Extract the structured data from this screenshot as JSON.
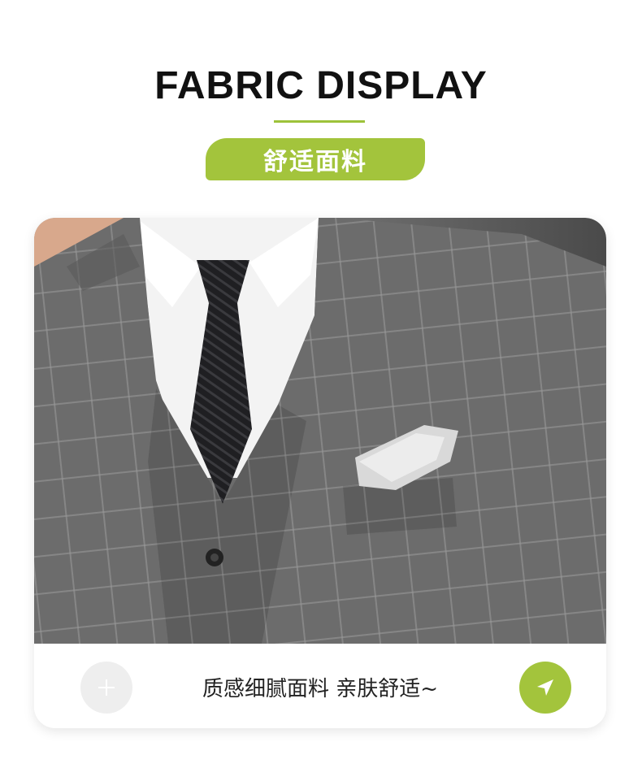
{
  "header": {
    "title": "FABRIC DISPLAY",
    "badge_label": "舒适面料"
  },
  "card": {
    "image_alt_icon": "suit-fabric-photo",
    "caption": "质感细腻面料 亲肤舒适~",
    "left_button_icon": "plus-icon",
    "right_button_icon": "send-icon"
  },
  "colors": {
    "accent": "#a3c43c",
    "heading": "#111111",
    "caption": "#222222",
    "suit_gray": "#6b6b6b"
  }
}
